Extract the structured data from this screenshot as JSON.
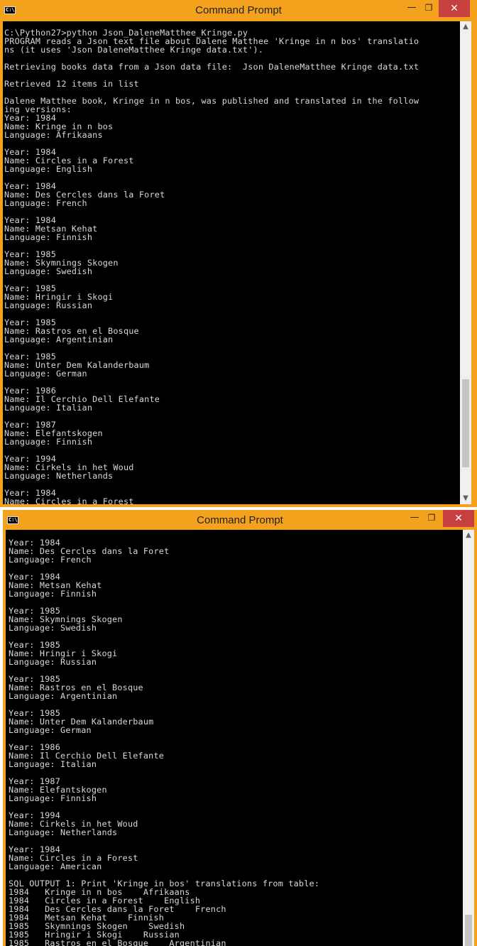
{
  "window1": {
    "title": "Command Prompt",
    "icon_text": "C:\\",
    "controls": {
      "minimize": "—",
      "maximize": "❐",
      "close": "✕"
    },
    "console_text": "C:\\Python27>python Json_DaleneMatthee_Kringe.py\nPROGRAM reads a Json text file about Dalene Matthee 'Kringe in n bos' translatio\nns (it uses 'Json DaleneMatthee Kringe data.txt').\n\nRetrieving books data from a Json data file:  Json DaleneMatthee Kringe data.txt\n\nRetrieved 12 items in list\n\nDalene Matthee book, Kringe in n bos, was published and translated in the follow\ning versions:\nYear: 1984\nName: Kringe in n bos\nLanguage: Afrikaans\n\nYear: 1984\nName: Circles in a Forest\nLanguage: English\n\nYear: 1984\nName: Des Cercles dans la Foret\nLanguage: French\n\nYear: 1984\nName: Metsan Kehat\nLanguage: Finnish\n\nYear: 1985\nName: Skymnings Skogen\nLanguage: Swedish\n\nYear: 1985\nName: Hringir i Skogi\nLanguage: Russian\n\nYear: 1985\nName: Rastros en el Bosque\nLanguage: Argentinian\n\nYear: 1985\nName: Unter Dem Kalanderbaum\nLanguage: German\n\nYear: 1986\nName: Il Cerchio Dell Elefante\nLanguage: Italian\n\nYear: 1987\nName: Elefantskogen\nLanguage: Finnish\n\nYear: 1994\nName: Cirkels in het Woud\nLanguage: Netherlands\n\nYear: 1984\nName: Circles in a Forest"
  },
  "window2": {
    "title": "Command Prompt",
    "icon_text": "C:\\",
    "controls": {
      "minimize": "—",
      "maximize": "❐",
      "close": "✕"
    },
    "console_text": "Year: 1984\nName: Des Cercles dans la Foret\nLanguage: French\n\nYear: 1984\nName: Metsan Kehat\nLanguage: Finnish\n\nYear: 1985\nName: Skymnings Skogen\nLanguage: Swedish\n\nYear: 1985\nName: Hringir i Skogi\nLanguage: Russian\n\nYear: 1985\nName: Rastros en el Bosque\nLanguage: Argentinian\n\nYear: 1985\nName: Unter Dem Kalanderbaum\nLanguage: German\n\nYear: 1986\nName: Il Cerchio Dell Elefante\nLanguage: Italian\n\nYear: 1987\nName: Elefantskogen\nLanguage: Finnish\n\nYear: 1994\nName: Cirkels in het Woud\nLanguage: Netherlands\n\nYear: 1984\nName: Circles in a Forest\nLanguage: American\n\nSQL OUTPUT 1: Print 'Kringe in bos' translations from table:\n1984   Kringe in n bos    Afrikaans\n1984   Circles in a Forest    English\n1984   Des Cercles dans la Foret    French\n1984   Metsan Kehat    Finnish\n1985   Skymnings Skogen    Swedish\n1985   Hringir i Skogi    Russian\n1985   Rastros en el Bosque    Argentinian"
  },
  "colors": {
    "titlebar": "#f4a11d",
    "console_bg": "#000000",
    "console_fg": "#d8d8d8",
    "close_button": "#c74040"
  },
  "icons": [
    "cmd-app-icon",
    "minimize-icon",
    "maximize-icon",
    "close-icon",
    "scroll-up-arrow-icon",
    "scroll-down-arrow-icon"
  ]
}
